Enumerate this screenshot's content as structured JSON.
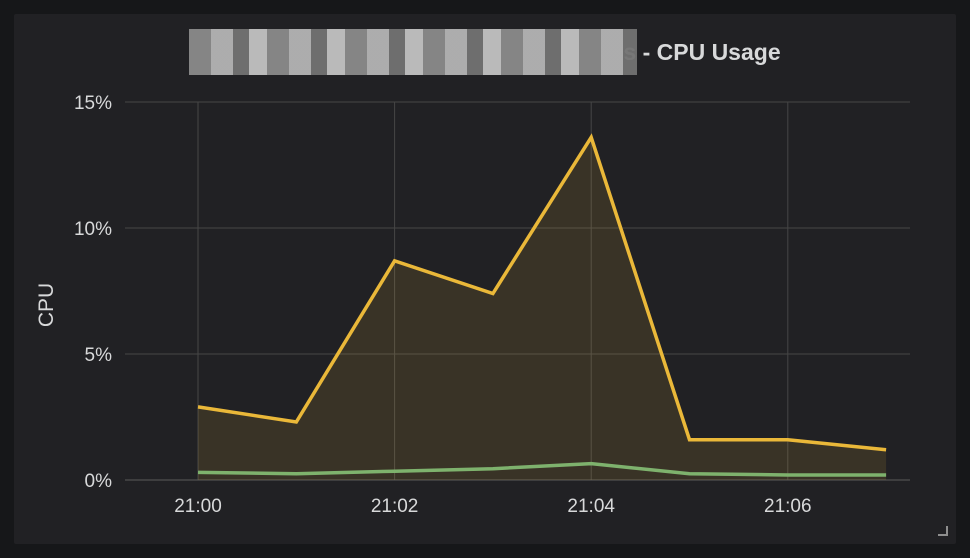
{
  "panel": {
    "title": "s - CPU Usage"
  },
  "chart_data": {
    "type": "area",
    "title": "s - CPU Usage",
    "xlabel": "",
    "ylabel": "CPU",
    "x": [
      "21:00",
      "21:01",
      "21:02",
      "21:03",
      "21:04",
      "21:05",
      "21:06",
      "21:07"
    ],
    "x_ticks": [
      "21:00",
      "21:02",
      "21:04",
      "21:06"
    ],
    "y_ticks": [
      "0%",
      "5%",
      "10%",
      "15%"
    ],
    "ylim": [
      0,
      15
    ],
    "grid": true,
    "series": [
      {
        "color": "#eab839",
        "values": [
          2.9,
          2.3,
          8.7,
          7.4,
          13.6,
          1.6,
          1.6,
          1.2
        ],
        "fill": true
      },
      {
        "color": "#7eb26d",
        "values": [
          0.3,
          0.25,
          0.35,
          0.45,
          0.65,
          0.25,
          0.2,
          0.2
        ],
        "fill": false
      }
    ]
  }
}
